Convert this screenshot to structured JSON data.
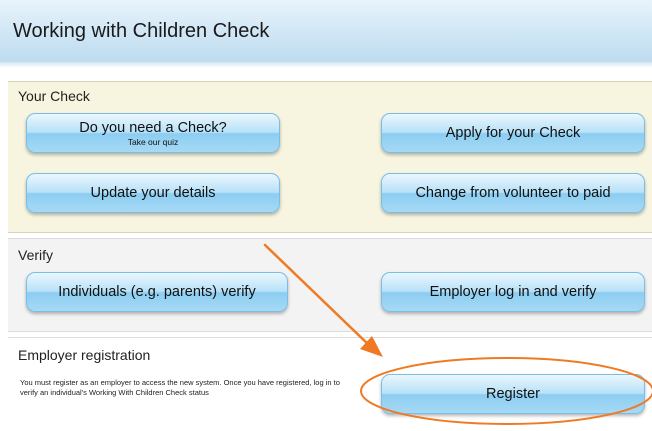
{
  "header": {
    "title": "Working with Children Check"
  },
  "your_check": {
    "title": "Your Check",
    "buttons": {
      "need_check": {
        "label": "Do you need a Check?",
        "sub": "Take our quiz"
      },
      "apply": {
        "label": "Apply for your Check"
      },
      "update": {
        "label": "Update your details"
      },
      "change": {
        "label": "Change from volunteer to paid"
      }
    }
  },
  "verify": {
    "title": "Verify",
    "buttons": {
      "individuals": {
        "label": "Individuals (e.g. parents) verify"
      },
      "employer": {
        "label": "Employer log in and verify"
      }
    }
  },
  "registration": {
    "title": "Employer registration",
    "text": "You must register as an employer to access the new system. Once you have registered, log in to verify an individual's Working With Children Check status",
    "button": {
      "label": "Register"
    }
  },
  "annotation": {
    "color": "#f07a23"
  }
}
